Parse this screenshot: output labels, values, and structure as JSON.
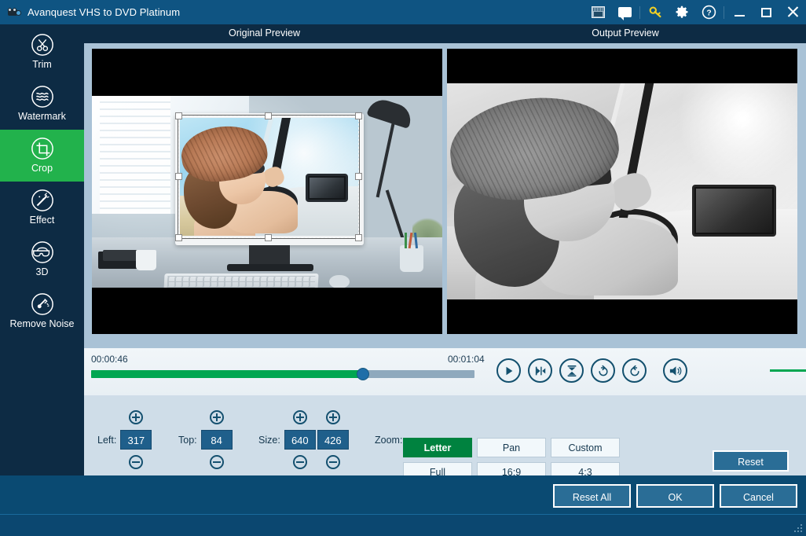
{
  "window": {
    "title": "Avanquest VHS to DVD Platinum",
    "app_icon": "camcorder-icon",
    "toolbar_icons": [
      {
        "name": "screenshot-icon",
        "label": "Screenshot"
      },
      {
        "name": "chat-icon",
        "label": "Chat"
      },
      {
        "name": "key-icon",
        "label": "Register"
      },
      {
        "name": "gear-icon",
        "label": "Settings"
      },
      {
        "name": "help-icon",
        "label": "Help"
      }
    ],
    "controls": [
      {
        "name": "minimize-button",
        "label": "Minimize"
      },
      {
        "name": "maximize-button",
        "label": "Maximize"
      },
      {
        "name": "close-button",
        "label": "Close"
      }
    ]
  },
  "sidebar": {
    "items": [
      {
        "label": "Trim",
        "icon": "scissors-icon",
        "active": false
      },
      {
        "label": "Watermark",
        "icon": "waves-icon",
        "active": false
      },
      {
        "label": "Crop",
        "icon": "crop-icon",
        "active": true
      },
      {
        "label": "Effect",
        "icon": "magic-wand-icon",
        "active": false
      },
      {
        "label": "3D",
        "icon": "glasses-3d-icon",
        "active": false
      },
      {
        "label": "Remove Noise",
        "icon": "noise-icon",
        "active": false
      }
    ]
  },
  "preview": {
    "original_label": "Original Preview",
    "output_label": "Output Preview"
  },
  "transport": {
    "current_time": "00:00:46",
    "total_time": "00:01:04",
    "progress_percent": 71,
    "volume_percent": 94,
    "buttons": [
      {
        "name": "play-button",
        "label": "Play"
      },
      {
        "name": "set-start-button",
        "label": "Set Start"
      },
      {
        "name": "set-end-button",
        "label": "Set End"
      },
      {
        "name": "rotate-right-button",
        "label": "Rotate Right"
      },
      {
        "name": "rotate-left-button",
        "label": "Rotate Left"
      },
      {
        "name": "volume-button",
        "label": "Volume"
      }
    ]
  },
  "crop_controls": {
    "left": {
      "label": "Left:",
      "value": "317"
    },
    "top": {
      "label": "Top:",
      "value": "84"
    },
    "size": {
      "label": "Size:",
      "width": "640",
      "height": "426"
    },
    "zoom": {
      "label": "Zoom:",
      "options": [
        {
          "label": "Letter",
          "active": true
        },
        {
          "label": "Pan",
          "active": false
        },
        {
          "label": "Custom",
          "active": false
        },
        {
          "label": "Full",
          "active": false
        },
        {
          "label": "16:9",
          "active": false
        },
        {
          "label": "4:3",
          "active": false
        }
      ]
    },
    "reset_label": "Reset"
  },
  "footer": {
    "reset_all_label": "Reset All",
    "ok_label": "OK",
    "cancel_label": "Cancel"
  },
  "colors": {
    "titlebar": "#0f5482",
    "sidebar": "#0d2b44",
    "accent_green": "#22b24c",
    "active_zoom_green": "#00823f",
    "progress_green": "#00a651",
    "panel": "#cfdde8",
    "button_blue": "#2a6d96",
    "footer": "#0a4a72"
  }
}
